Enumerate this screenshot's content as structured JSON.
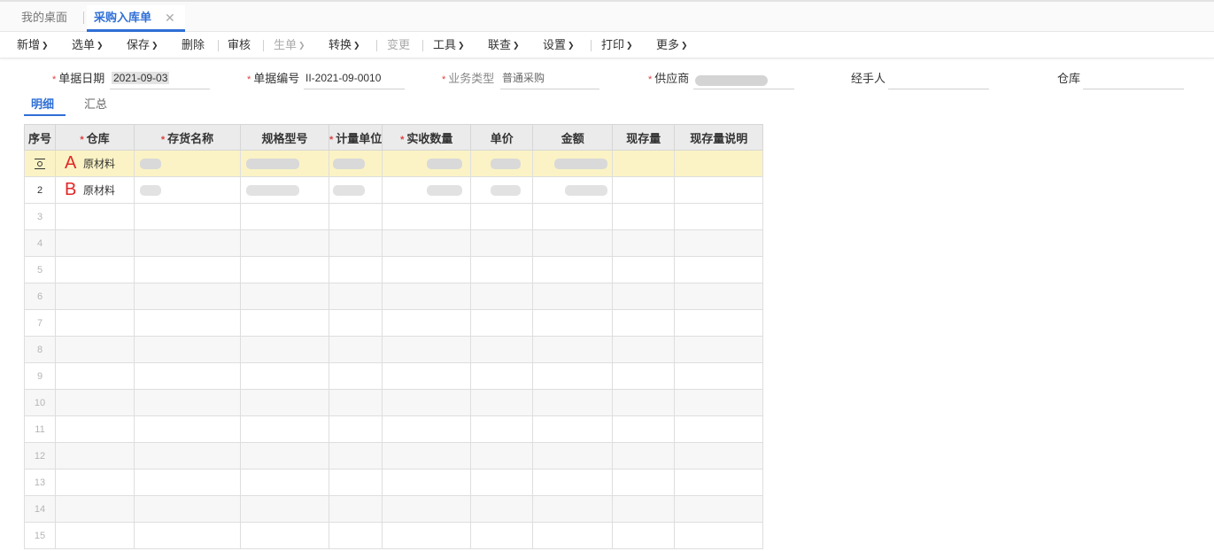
{
  "tabs": {
    "home": "我的桌面",
    "active": "采购入库单",
    "close_glyph": "✕"
  },
  "toolbar": [
    {
      "label": "新增",
      "dropdown": true,
      "disabled": false
    },
    {
      "label": "选单",
      "dropdown": true,
      "disabled": false
    },
    {
      "label": "保存",
      "dropdown": true,
      "disabled": false
    },
    {
      "label": "删除",
      "dropdown": false,
      "disabled": false
    },
    {
      "label": "审核",
      "dropdown": false,
      "disabled": false
    },
    {
      "label": "生单",
      "dropdown": true,
      "disabled": true
    },
    {
      "label": "转换",
      "dropdown": true,
      "disabled": false
    },
    {
      "label": "变更",
      "dropdown": false,
      "disabled": true
    },
    {
      "label": "工具",
      "dropdown": true,
      "disabled": false
    },
    {
      "label": "联查",
      "dropdown": true,
      "disabled": false
    },
    {
      "label": "设置",
      "dropdown": true,
      "disabled": false
    },
    {
      "label": "打印",
      "dropdown": true,
      "disabled": false
    },
    {
      "label": "更多",
      "dropdown": true,
      "disabled": false
    }
  ],
  "form": {
    "date_label": "单据日期",
    "date_value": "2021-09-03",
    "code_label": "单据编号",
    "code_value": "II-2021-09-0010",
    "biz_type_label": "业务类型",
    "biz_type_value": "普通采购",
    "supplier_label": "供应商",
    "handler_label": "经手人",
    "warehouse_label": "仓库",
    "required_mark": "*"
  },
  "subtabs": {
    "detail": "明细",
    "summary": "汇总"
  },
  "grid": {
    "columns": [
      "序号",
      "仓库",
      "存货名称",
      "规格型号",
      "计量单位",
      "实收数量",
      "单价",
      "金额",
      "现存量",
      "现存量说明"
    ],
    "required_columns": [
      1,
      2,
      4,
      5
    ],
    "rows": [
      {
        "no": "",
        "marker": "A",
        "warehouse": "原材料"
      },
      {
        "no": "2",
        "marker": "B",
        "warehouse": "原材料"
      },
      {
        "no": "3"
      },
      {
        "no": "4"
      },
      {
        "no": "5"
      },
      {
        "no": "6"
      },
      {
        "no": "7"
      },
      {
        "no": "8"
      },
      {
        "no": "9"
      },
      {
        "no": "10"
      },
      {
        "no": "11"
      },
      {
        "no": "12"
      },
      {
        "no": "13"
      },
      {
        "no": "14"
      },
      {
        "no": "15"
      }
    ]
  },
  "colors": {
    "accent": "#2f6fd6",
    "required": "#e03e3e",
    "marker": "#e32626",
    "selected_row": "#fbf3c5"
  }
}
